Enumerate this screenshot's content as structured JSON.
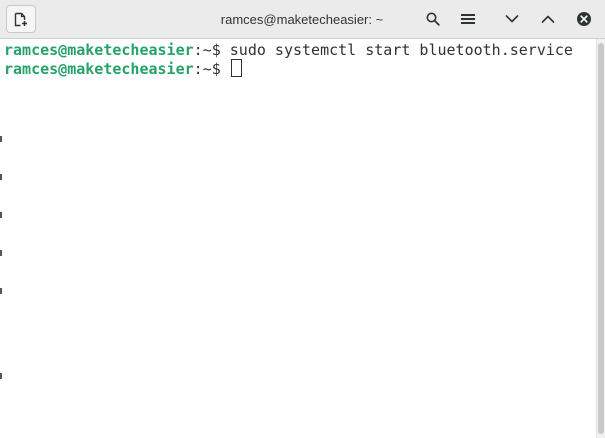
{
  "window": {
    "title": "ramces@maketecheasier: ~"
  },
  "titlebar": {
    "new_tab_icon": "new-tab-icon",
    "search_icon": "search-icon",
    "menu_icon": "hamburger-menu-icon",
    "minimize_icon": "chevron-down-icon",
    "maximize_icon": "chevron-up-icon",
    "close_icon": "close-icon"
  },
  "terminal": {
    "lines": [
      {
        "user_host": "ramces@maketecheasier",
        "path": ":~$ ",
        "command": "sudo systemctl start bluetooth.service"
      },
      {
        "user_host": "ramces@maketecheasier",
        "path": ":~$ ",
        "command": ""
      }
    ]
  },
  "colors": {
    "prompt_user": "#26a269",
    "text": "#2e3436",
    "titlebar_bg": "#ebebeb",
    "close_button": "#2e3436"
  }
}
